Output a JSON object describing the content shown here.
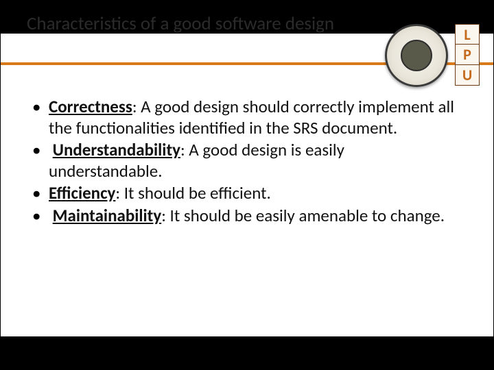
{
  "title": "Characteristics of a good software design",
  "badge": {
    "l": "L",
    "p": "P",
    "u": "U"
  },
  "bullets": [
    {
      "term": "Correctness",
      "text": ": A good design should correctly implement all the functionalities identified in the SRS document."
    },
    {
      "term": "Understandability",
      "text": ": A good design is easily understandable."
    },
    {
      "term": "Efficiency",
      "text": ": It should be efficient."
    },
    {
      "term": "Maintainability",
      "text": ": It should be easily amenable to change."
    }
  ]
}
